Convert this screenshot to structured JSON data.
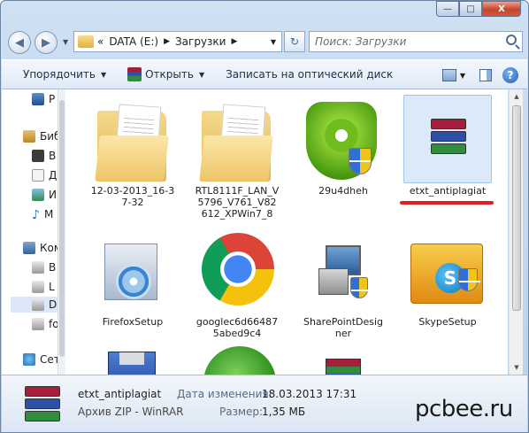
{
  "window": {
    "caption": {
      "minimize": "—",
      "maximize": "□",
      "close": "X"
    }
  },
  "address": {
    "chevrons": "«",
    "segments": [
      "DATA (E:)",
      "Загрузки"
    ],
    "search_placeholder": "Поиск: Загрузки"
  },
  "toolbar": {
    "organize": "Упорядочить",
    "open": "Открыть",
    "burn": "Записать на оптический диск",
    "help": "?"
  },
  "sidebar": {
    "items": [
      {
        "label": "Р",
        "icon": "desktop-icon"
      },
      {
        "label": "Биб",
        "icon": "library-icon"
      },
      {
        "label": "В",
        "icon": "video-icon"
      },
      {
        "label": "Д",
        "icon": "documents-icon"
      },
      {
        "label": "И",
        "icon": "images-icon"
      },
      {
        "label": "М",
        "icon": "music-icon"
      },
      {
        "label": "Ком",
        "icon": "computer-icon"
      },
      {
        "label": "В",
        "icon": "drive-icon"
      },
      {
        "label": "L",
        "icon": "drive-icon"
      },
      {
        "label": "D",
        "icon": "drive-icon"
      },
      {
        "label": "fo",
        "icon": "drive-icon"
      },
      {
        "label": "Сет",
        "icon": "network-icon"
      }
    ]
  },
  "files": [
    {
      "name": "12-03-2013_16-37-32",
      "icon": "folder-icon"
    },
    {
      "name": "RTL8111F_LAN_V5796_V761_V82612_XPWin7_8",
      "icon": "folder-icon"
    },
    {
      "name": "29u4dheh",
      "icon": "drweb-shield-icon"
    },
    {
      "name": "etxt_antiplagiat",
      "icon": "winrar-archive-icon",
      "selected": true
    },
    {
      "name": "FirefoxSetup",
      "icon": "setup-cd-icon"
    },
    {
      "name": "googlec6d664875abed9c4",
      "icon": "chrome-icon"
    },
    {
      "name": "SharePointDesigner",
      "icon": "installer-icon"
    },
    {
      "name": "SkypeSetup",
      "icon": "skype-icon"
    },
    {
      "name": "",
      "icon": "floppy-icon"
    },
    {
      "name": "",
      "icon": "utorrent-icon"
    },
    {
      "name": "",
      "icon": "winrar-icon"
    }
  ],
  "details": {
    "name": "etxt_antiplagiat",
    "type": "Архив ZIP - WinRAR",
    "modified_label": "Дата изменения:",
    "modified_value": "18.03.2013 17:31",
    "size_label": "Размер:",
    "size_value": "1,35 МБ"
  },
  "watermark": "pcbee.ru",
  "colors": {
    "accent": "#e41e1e",
    "selection": "#dbe9f8"
  }
}
